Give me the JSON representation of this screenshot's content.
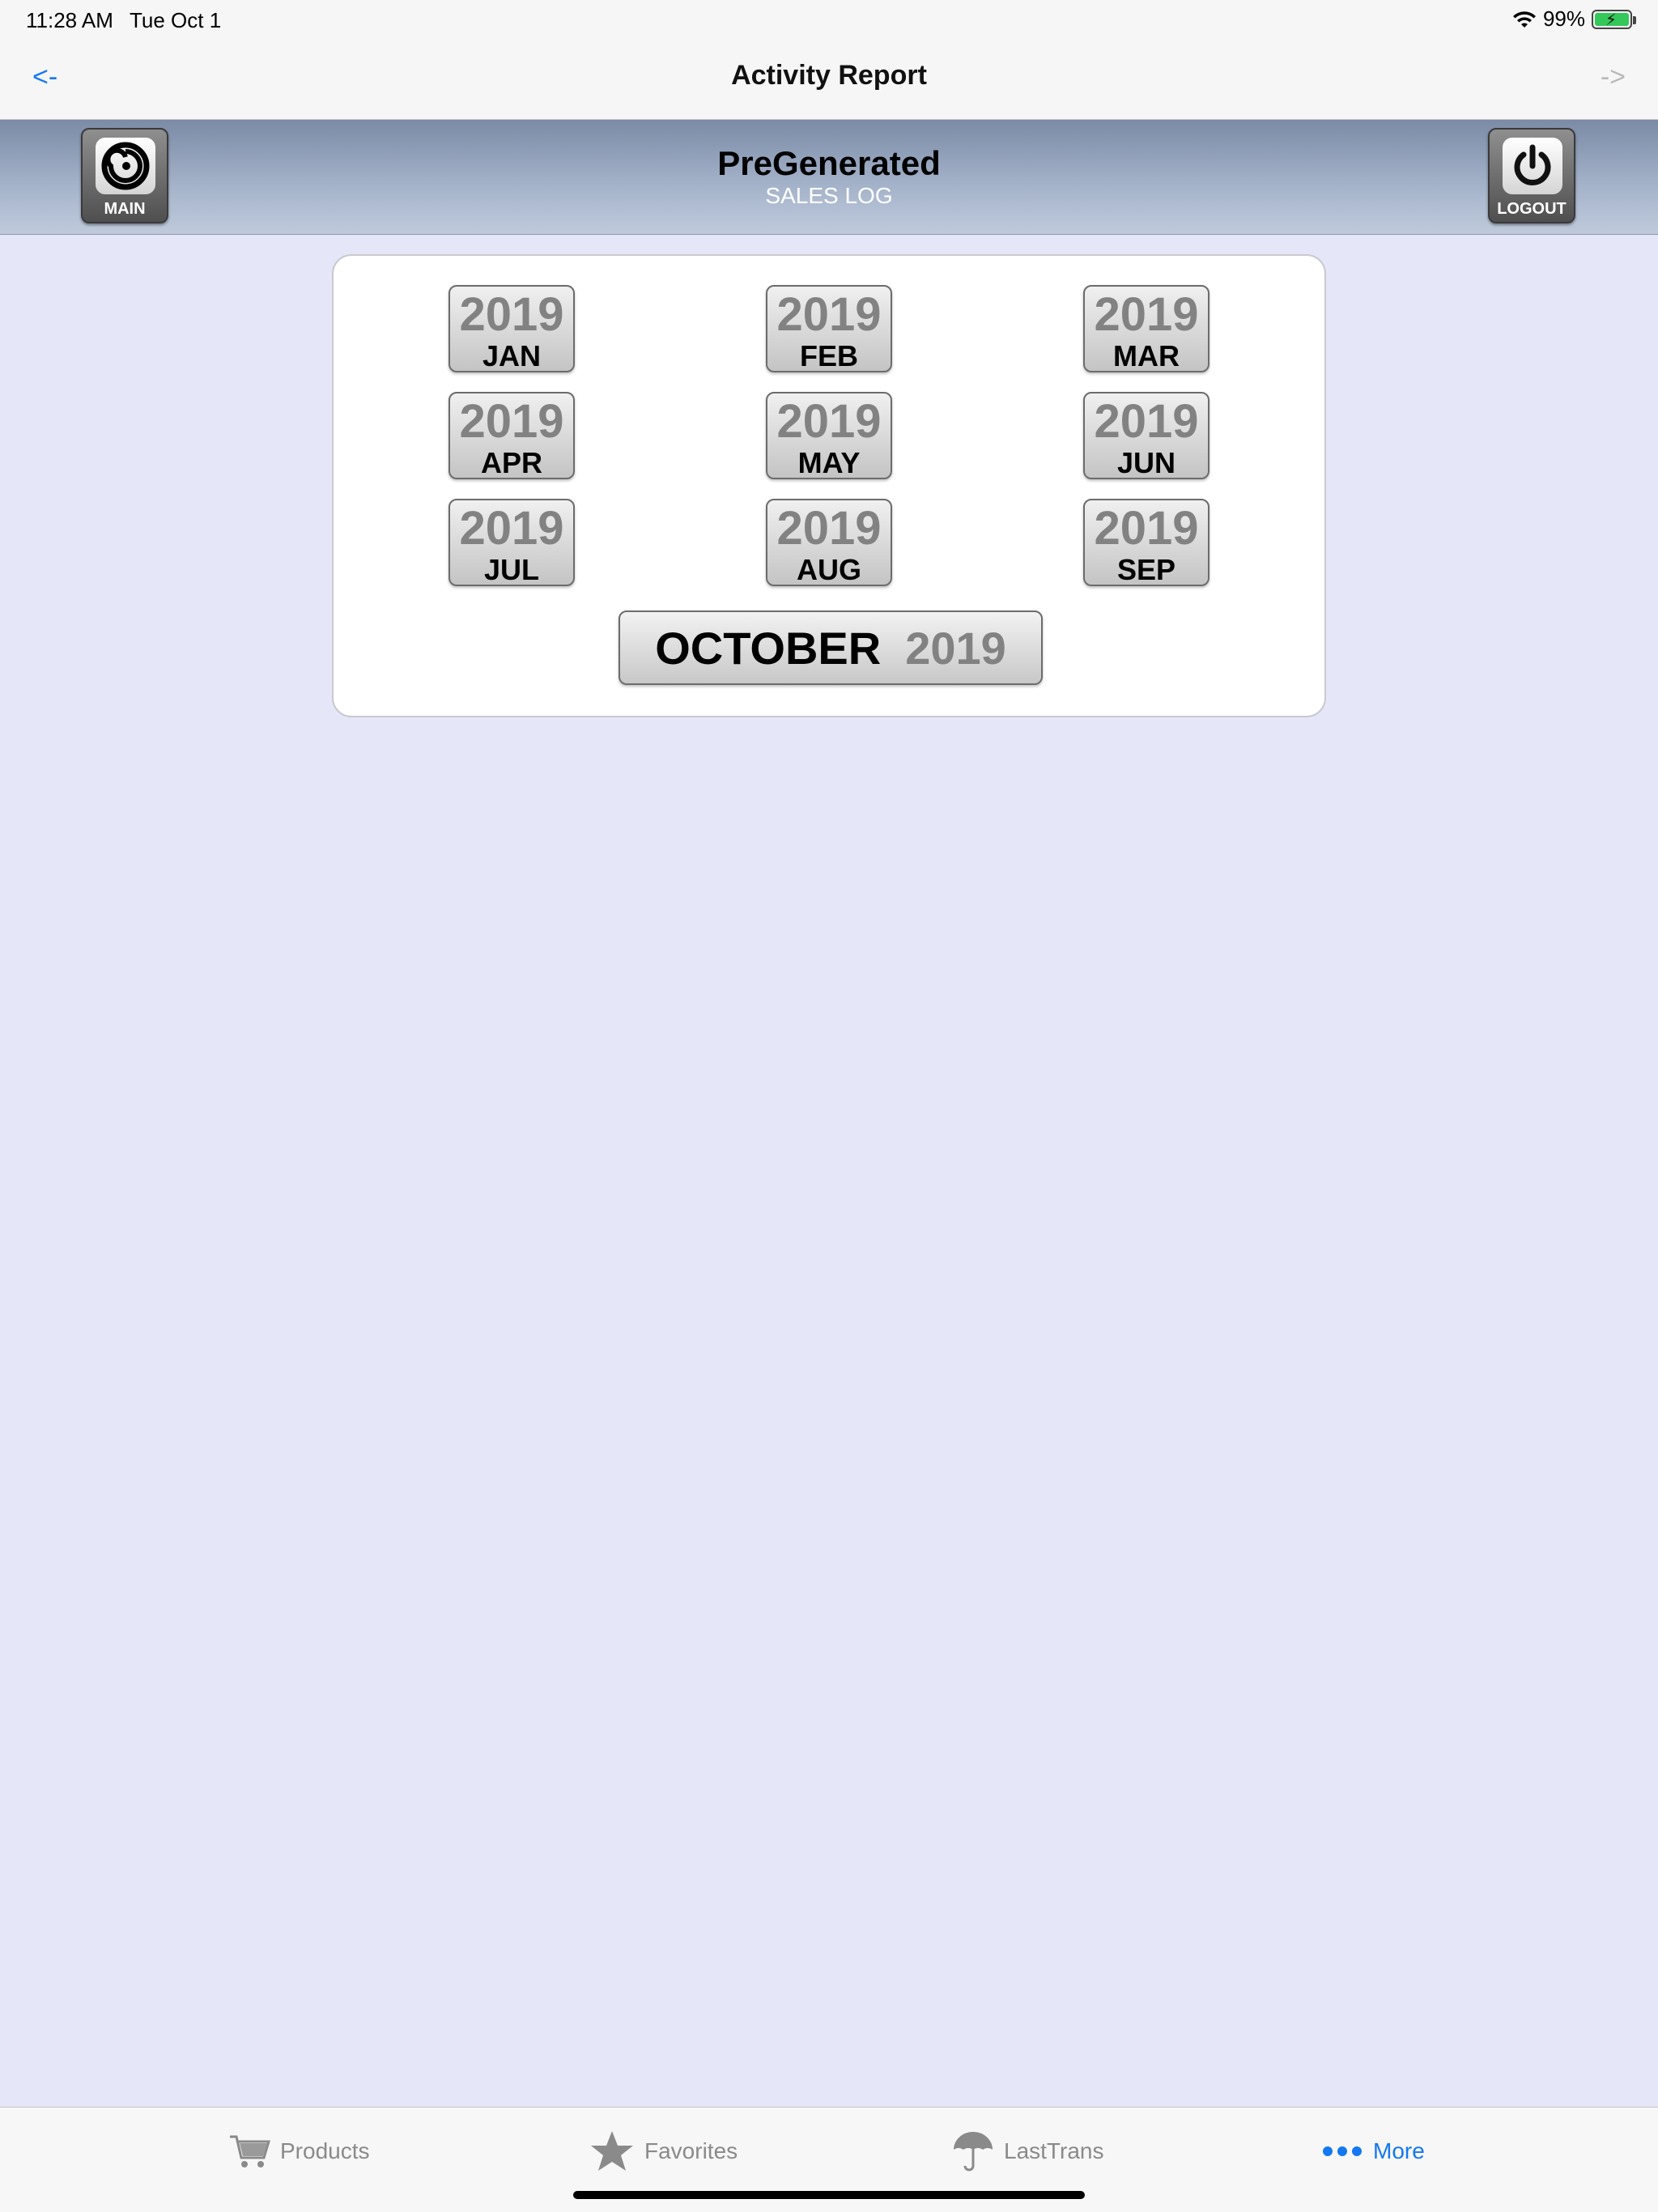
{
  "status_bar": {
    "time": "11:28 AM",
    "date": "Tue Oct 1",
    "battery": "99%"
  },
  "nav": {
    "back": "<-",
    "forward": "->",
    "title": "Activity Report"
  },
  "header": {
    "main_label": "MAIN",
    "title": "PreGenerated",
    "subtitle": "SALES LOG",
    "logout_label": "LOGOUT"
  },
  "months": [
    {
      "year": "2019",
      "month": "JAN"
    },
    {
      "year": "2019",
      "month": "FEB"
    },
    {
      "year": "2019",
      "month": "MAR"
    },
    {
      "year": "2019",
      "month": "APR"
    },
    {
      "year": "2019",
      "month": "MAY"
    },
    {
      "year": "2019",
      "month": "JUN"
    },
    {
      "year": "2019",
      "month": "JUL"
    },
    {
      "year": "2019",
      "month": "AUG"
    },
    {
      "year": "2019",
      "month": "SEP"
    }
  ],
  "current": {
    "month": "OCTOBER",
    "year": "2019"
  },
  "tabs": [
    {
      "label": "Products",
      "icon": "cart-icon"
    },
    {
      "label": "Favorites",
      "icon": "star-icon"
    },
    {
      "label": "LastTrans",
      "icon": "umbrella-icon"
    },
    {
      "label": "More",
      "icon": "more-icon",
      "active": true
    }
  ],
  "colors": {
    "accent": "#1478f0",
    "background": "#e5e6f8"
  }
}
